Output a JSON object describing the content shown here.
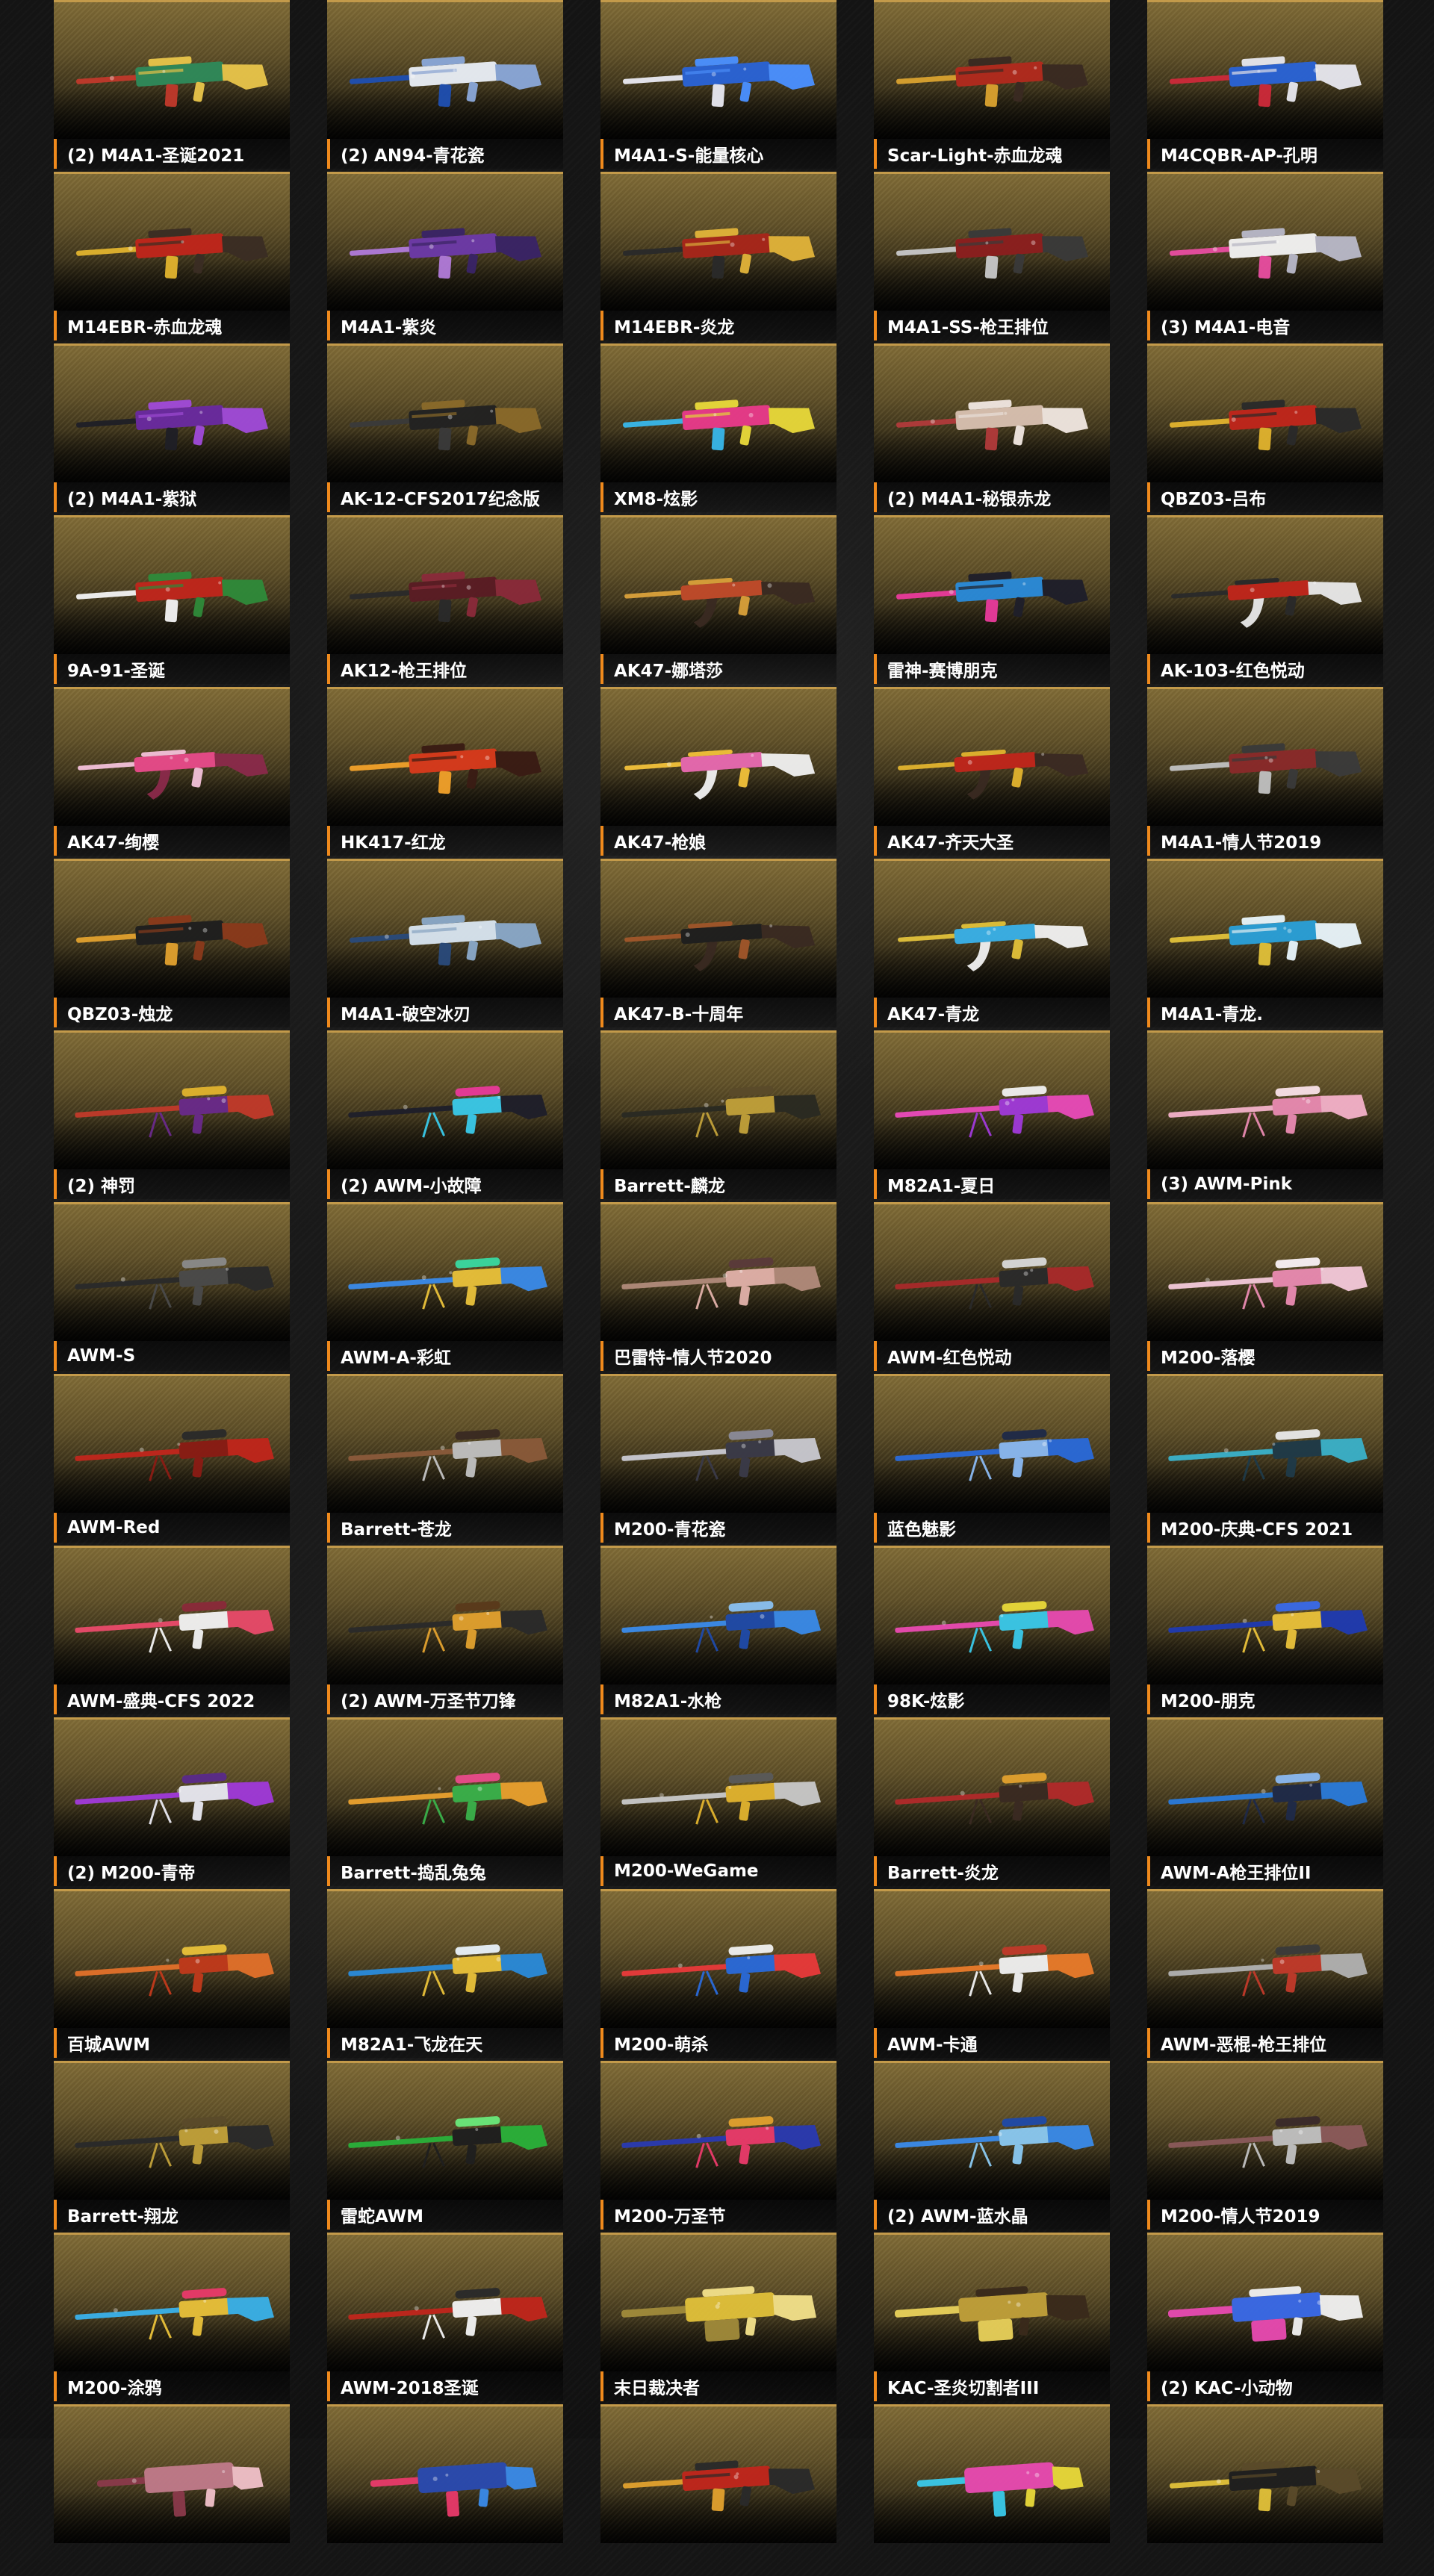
{
  "weapon_skins": [
    {
      "name": "(2) M4A1-圣诞2021",
      "palette": [
        "#2f8a5a",
        "#c0392b",
        "#e8c44a"
      ],
      "type": "rifle"
    },
    {
      "name": "(2) AN94-青花瓷",
      "palette": [
        "#e9eef5",
        "#1f4fb0",
        "#8aa7d8"
      ],
      "type": "rifle"
    },
    {
      "name": "M4A1-S-能量核心",
      "palette": [
        "#2a63d6",
        "#e8e8f0",
        "#4a90ff"
      ],
      "type": "rifle"
    },
    {
      "name": "Scar-Light-赤血龙魂",
      "palette": [
        "#b12a1e",
        "#d9a12f",
        "#3a2a22"
      ],
      "type": "rifle"
    },
    {
      "name": "M4CQBR-AP-孔明",
      "palette": [
        "#2a63d6",
        "#cc2a3a",
        "#e6e6ee"
      ],
      "type": "rifle"
    },
    {
      "name": "M14EBR-赤血龙魂",
      "palette": [
        "#c0261c",
        "#e0b22e",
        "#3b2d24"
      ],
      "type": "rifle"
    },
    {
      "name": "M4A1-紫炎",
      "palette": [
        "#6d3aa8",
        "#b07ad8",
        "#3a2466"
      ],
      "type": "rifle"
    },
    {
      "name": "M14EBR-炎龙",
      "palette": [
        "#a8261b",
        "#2a2a2a",
        "#e0b23a"
      ],
      "type": "rifle"
    },
    {
      "name": "M4A1-SS-枪王排位",
      "palette": [
        "#8c1f1f",
        "#c7c7c7",
        "#3a3a3a"
      ],
      "type": "rifle"
    },
    {
      "name": "(3) M4A1-电音",
      "palette": [
        "#f3f3f3",
        "#e84ea0",
        "#b8b8c8"
      ],
      "type": "rifle"
    },
    {
      "name": "(2) M4A1-紫狱",
      "palette": [
        "#6a2aa0",
        "#1f1f26",
        "#a04ad8"
      ],
      "type": "rifle"
    },
    {
      "name": "AK-12-CFS2017纪念版",
      "palette": [
        "#222222",
        "#3a3a3a",
        "#8a6a2a"
      ],
      "type": "rifle"
    },
    {
      "name": "XM8-炫影",
      "palette": [
        "#e83a8a",
        "#38b6e8",
        "#e8d83a"
      ],
      "type": "rifle"
    },
    {
      "name": "(2) M4A1-秘银赤龙",
      "palette": [
        "#d8c0b0",
        "#b03a3a",
        "#f0e6e0"
      ],
      "type": "rifle"
    },
    {
      "name": "QBZ03-吕布",
      "palette": [
        "#c0261c",
        "#e0b22e",
        "#2a2a2a"
      ],
      "type": "rifle"
    },
    {
      "name": "9A-91-圣诞",
      "palette": [
        "#c0261c",
        "#f2f2f2",
        "#2f8a3a"
      ],
      "type": "rifle"
    },
    {
      "name": "AK12-枪王排位",
      "palette": [
        "#5a1c24",
        "#2a2a2a",
        "#8a2a3a"
      ],
      "type": "rifle"
    },
    {
      "name": "AK47-娜塔莎",
      "palette": [
        "#c04a2a",
        "#d8a03a",
        "#3a2a22"
      ],
      "type": "ak"
    },
    {
      "name": "雷神-赛博朋克",
      "palette": [
        "#2a8ad8",
        "#e83a9a",
        "#1f1f2a"
      ],
      "type": "rifle"
    },
    {
      "name": "AK-103-红色悦动",
      "palette": [
        "#c0261c",
        "#2a2a2a",
        "#e8e8e8"
      ],
      "type": "ak"
    },
    {
      "name": "AK47-绚樱",
      "palette": [
        "#e84a8a",
        "#f2c0d8",
        "#8a2a4a"
      ],
      "type": "ak"
    },
    {
      "name": "HK417-红龙",
      "palette": [
        "#d83a1c",
        "#f0a02a",
        "#3a1c14"
      ],
      "type": "rifle"
    },
    {
      "name": "AK47-枪娘",
      "palette": [
        "#e86ab0",
        "#f0c03a",
        "#f0f0f0"
      ],
      "type": "ak"
    },
    {
      "name": "AK47-齐天大圣",
      "palette": [
        "#c0261c",
        "#e0b22e",
        "#3a2a22"
      ],
      "type": "ak"
    },
    {
      "name": "M4A1-情人节2019",
      "palette": [
        "#8a2a2a",
        "#c0c0c0",
        "#3a3a3a"
      ],
      "type": "rifle"
    },
    {
      "name": "QBZ03-烛龙",
      "palette": [
        "#1f1f1f",
        "#e0a02e",
        "#8a3a1c"
      ],
      "type": "rifle"
    },
    {
      "name": "M4A1-破空冰刃",
      "palette": [
        "#d8e4f0",
        "#2a4a7a",
        "#8aa8c8"
      ],
      "type": "rifle"
    },
    {
      "name": "AK47-B-十周年",
      "palette": [
        "#1f1f1f",
        "#a0562a",
        "#3a2a22"
      ],
      "type": "ak"
    },
    {
      "name": "AK47-青龙",
      "palette": [
        "#3ab0e8",
        "#e0c03a",
        "#f0f0f0"
      ],
      "type": "ak"
    },
    {
      "name": "M4A1-青龙.",
      "palette": [
        "#2aa0d8",
        "#e0c03a",
        "#e8f4fa"
      ],
      "type": "rifle"
    },
    {
      "name": "(2) 神罚",
      "palette": [
        "#c03a2a",
        "#6a2a8a",
        "#e0b22e"
      ],
      "type": "sniper"
    },
    {
      "name": "(2) AWM-小故障",
      "palette": [
        "#1f1f2a",
        "#3ac8e8",
        "#e83a9a"
      ],
      "type": "sniper"
    },
    {
      "name": "Barrett-麟龙",
      "palette": [
        "#2a2a22",
        "#c0a03a",
        "#5a4a2a"
      ],
      "type": "sniper"
    },
    {
      "name": "M82A1-夏日",
      "palette": [
        "#e84ab8",
        "#a03ad8",
        "#f0f0f0"
      ],
      "type": "sniper"
    },
    {
      "name": "(3) AWM-Pink",
      "palette": [
        "#f2b0c8",
        "#e88ab0",
        "#f8e0e8"
      ],
      "type": "sniper"
    },
    {
      "name": "AWM-S",
      "palette": [
        "#2a2a2a",
        "#4a4a4a",
        "#8a8a8a"
      ],
      "type": "sniper"
    },
    {
      "name": "AWM-A-彩虹",
      "palette": [
        "#3a8ae8",
        "#e8c03a",
        "#3ad8a0"
      ],
      "type": "sniper"
    },
    {
      "name": "巴雷特-情人节2020",
      "palette": [
        "#b08a7a",
        "#e0b0a8",
        "#5a3a3a"
      ],
      "type": "sniper"
    },
    {
      "name": "AWM-红色悦动",
      "palette": [
        "#a82a2a",
        "#2a2a2a",
        "#d8d8d8"
      ],
      "type": "sniper"
    },
    {
      "name": "M200-落樱",
      "palette": [
        "#f2c8d8",
        "#e88ab0",
        "#f8f0f4"
      ],
      "type": "sniper"
    },
    {
      "name": "AWM-Red",
      "palette": [
        "#c0261c",
        "#8a1c14",
        "#2a2a2a"
      ],
      "type": "sniper"
    },
    {
      "name": "Barrett-苍龙",
      "palette": [
        "#8a5a3a",
        "#c0c0c0",
        "#3a2a22"
      ],
      "type": "sniper"
    },
    {
      "name": "M200-青花瓷",
      "palette": [
        "#c8c8d0",
        "#3a3a48",
        "#8a8a98"
      ],
      "type": "sniper"
    },
    {
      "name": "蓝色魅影",
      "palette": [
        "#2a6ad8",
        "#8ab8f0",
        "#1f2a48"
      ],
      "type": "sniper"
    },
    {
      "name": "M200-庆典-CFS 2021",
      "palette": [
        "#3ab0c8",
        "#1f3a48",
        "#e8e8e8"
      ],
      "type": "sniper"
    },
    {
      "name": "AWM-盛典-CFS 2022",
      "palette": [
        "#e84a6a",
        "#f2f2f2",
        "#8a2a3a"
      ],
      "type": "sniper"
    },
    {
      "name": "(2) AWM-万圣节刀锋",
      "palette": [
        "#2a2a2a",
        "#e0a02e",
        "#5a3a1c"
      ],
      "type": "sniper"
    },
    {
      "name": "M82A1-水枪",
      "palette": [
        "#3a8ae8",
        "#1f4aa8",
        "#8ac0f0"
      ],
      "type": "sniper"
    },
    {
      "name": "98K-炫影",
      "palette": [
        "#e84ab0",
        "#3ac8e8",
        "#e8d83a"
      ],
      "type": "sniper"
    },
    {
      "name": "M200-朋克",
      "palette": [
        "#1f3ab0",
        "#e8c03a",
        "#3a6ae8"
      ],
      "type": "sniper"
    },
    {
      "name": "(2) M200-青帝",
      "palette": [
        "#a03ad8",
        "#e8e8f0",
        "#5a2a8a"
      ],
      "type": "sniper"
    },
    {
      "name": "Barrett-捣乱兔兔",
      "palette": [
        "#e8a02e",
        "#3ab04a",
        "#e84a8a"
      ],
      "type": "sniper"
    },
    {
      "name": "M200-WeGame",
      "palette": [
        "#c8c8c8",
        "#e0b22e",
        "#5a5a5a"
      ],
      "type": "sniper"
    },
    {
      "name": "Barrett-炎龙",
      "palette": [
        "#b02a2a",
        "#3a2a22",
        "#e0a02e"
      ],
      "type": "sniper"
    },
    {
      "name": "AWM-A枪王排位II",
      "palette": [
        "#2a7ad8",
        "#1f2a48",
        "#8ab8f0"
      ],
      "type": "sniper"
    },
    {
      "name": "百城AWM",
      "palette": [
        "#e0702a",
        "#c03a1c",
        "#e8c03a"
      ],
      "type": "sniper"
    },
    {
      "name": "M82A1-飞龙在天",
      "palette": [
        "#2a8ad8",
        "#e8c03a",
        "#e8f0f8"
      ],
      "type": "sniper"
    },
    {
      "name": "M200-萌杀",
      "palette": [
        "#e83a3a",
        "#2a6ad8",
        "#f0f0f0"
      ],
      "type": "sniper"
    },
    {
      "name": "AWM-卡通",
      "palette": [
        "#e87a2a",
        "#f0f0f0",
        "#c03a2a"
      ],
      "type": "sniper"
    },
    {
      "name": "AWM-恶棍-枪王排位",
      "palette": [
        "#b0b0b0",
        "#c03a2a",
        "#3a3a3a"
      ],
      "type": "sniper"
    },
    {
      "name": "Barrett-翔龙",
      "palette": [
        "#2a2a2a",
        "#c0a03a",
        "#5a4a2a"
      ],
      "type": "sniper"
    },
    {
      "name": "雷蛇AWM",
      "palette": [
        "#2ab03a",
        "#1f1f1f",
        "#6ae87a"
      ],
      "type": "sniper"
    },
    {
      "name": "M200-万圣节",
      "palette": [
        "#2a3ab0",
        "#e83a6a",
        "#e0a02e"
      ],
      "type": "sniper"
    },
    {
      "name": "(2) AWM-蓝水晶",
      "palette": [
        "#3a8ae8",
        "#8ac8f0",
        "#1f4aa8"
      ],
      "type": "sniper"
    },
    {
      "name": "M200-情人节2019",
      "palette": [
        "#8a5a5a",
        "#c0c0c0",
        "#3a2a2a"
      ],
      "type": "sniper"
    },
    {
      "name": "M200-涂鸦",
      "palette": [
        "#3ab0e8",
        "#e8c03a",
        "#e83a6a"
      ],
      "type": "sniper"
    },
    {
      "name": "AWM-2018圣诞",
      "palette": [
        "#c0261c",
        "#f2f2f2",
        "#2a2a2a"
      ],
      "type": "sniper"
    },
    {
      "name": "末日裁决者",
      "palette": [
        "#e0c03a",
        "#a08a3a",
        "#f2e08a"
      ],
      "type": "mg"
    },
    {
      "name": "KAC-圣炎切割者III",
      "palette": [
        "#c0a03a",
        "#e8d05a",
        "#3a2a1c"
      ],
      "type": "mg"
    },
    {
      "name": "(2) KAC-小动物",
      "palette": [
        "#3a6ae8",
        "#e84ab0",
        "#f0f0f0"
      ],
      "type": "mg"
    },
    {
      "name": "",
      "palette": [
        "#c07a8a",
        "#8a3a4a",
        "#f0c0c8"
      ],
      "type": "smg"
    },
    {
      "name": "",
      "palette": [
        "#2a4ab0",
        "#e83a6a",
        "#3a8ae8"
      ],
      "type": "smg"
    },
    {
      "name": "",
      "palette": [
        "#c0261c",
        "#e0a02e",
        "#2a2a2a"
      ],
      "type": "rifle"
    },
    {
      "name": "",
      "palette": [
        "#e84ab0",
        "#3ac8e8",
        "#e8d83a"
      ],
      "type": "smg"
    },
    {
      "name": "",
      "palette": [
        "#1f1f1f",
        "#e0c03a",
        "#5a4a2a"
      ],
      "type": "rifle"
    }
  ]
}
